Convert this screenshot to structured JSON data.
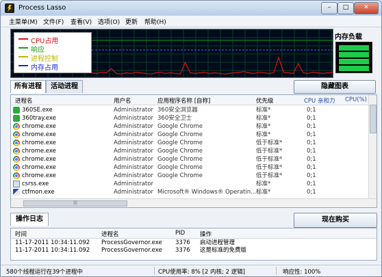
{
  "window": {
    "title": "Process Lasso",
    "minimize": "–",
    "maximize": "□",
    "close": "✕"
  },
  "menu": [
    {
      "label": "主菜单(M)"
    },
    {
      "label": "文件(F)"
    },
    {
      "label": "查看(V)"
    },
    {
      "label": "选项(O)"
    },
    {
      "label": "更新"
    },
    {
      "label": "帮助(H)"
    }
  ],
  "graph": {
    "legend": [
      {
        "label": "CPU占用",
        "color": "#e01010"
      },
      {
        "label": "响应",
        "color": "#1a9a1a"
      },
      {
        "label": "进程控制",
        "color": "#b8b800"
      },
      {
        "label": "内存占用",
        "color": "#1a2ad0"
      }
    ],
    "cpu_trace": [
      5,
      4,
      6,
      5,
      12,
      4,
      3,
      5,
      4,
      6,
      5,
      4,
      3,
      5,
      6,
      4,
      5,
      4,
      3,
      22,
      5,
      4,
      5,
      6,
      4,
      5,
      4,
      3,
      4,
      5,
      6,
      7,
      5,
      4,
      6,
      5,
      4,
      5,
      30,
      6,
      5,
      4,
      20,
      5,
      4,
      6,
      5,
      4,
      5,
      6
    ]
  },
  "memory": {
    "label": "内存负载"
  },
  "tabs": {
    "all_processes": "所有进程",
    "active_processes": "活动进程",
    "hide_graph_button": "隐藏图表"
  },
  "process_table": {
    "columns": [
      "进程名",
      "用户名",
      "应用程序名称 [自称]",
      "优先级",
      "CPU 亲和力",
      "CPU(%)"
    ],
    "rows": [
      {
        "icon": "green",
        "name": "360SE.exe",
        "user": "Administrator",
        "app": "360安全浏览器",
        "priority": "标准*",
        "affinity": "0;1"
      },
      {
        "icon": "green",
        "name": "360tray.exe",
        "user": "Administrator",
        "app": "360安全卫士",
        "priority": "标准*",
        "affinity": "0;1"
      },
      {
        "icon": "chrome",
        "name": "chrome.exe",
        "user": "Administrator",
        "app": "Google Chrome",
        "priority": "标准*",
        "affinity": "0;1"
      },
      {
        "icon": "chrome",
        "name": "chrome.exe",
        "user": "Administrator",
        "app": "Google Chrome",
        "priority": "标准*",
        "affinity": "0;1"
      },
      {
        "icon": "chrome",
        "name": "chrome.exe",
        "user": "Administrator",
        "app": "Google Chrome",
        "priority": "低于标准*",
        "affinity": "0;1"
      },
      {
        "icon": "chrome",
        "name": "chrome.exe",
        "user": "Administrator",
        "app": "Google Chrome",
        "priority": "低于标准*",
        "affinity": "0;1"
      },
      {
        "icon": "chrome",
        "name": "chrome.exe",
        "user": "Administrator",
        "app": "Google Chrome",
        "priority": "低于标准*",
        "affinity": "0;1"
      },
      {
        "icon": "chrome",
        "name": "chrome.exe",
        "user": "Administrator",
        "app": "Google Chrome",
        "priority": "低于标准*",
        "affinity": "0;1"
      },
      {
        "icon": "chrome",
        "name": "chrome.exe",
        "user": "Administrator",
        "app": "Google Chrome",
        "priority": "低于标准*",
        "affinity": "0;1"
      },
      {
        "icon": "win",
        "name": "csrss.exe",
        "user": "Administrator",
        "app": "",
        "priority": "标准*",
        "affinity": "0;1"
      },
      {
        "icon": "pen",
        "name": "ctfmon.exe",
        "user": "Administrator",
        "app": "Microsoft® Windows® Operatin...",
        "priority": "标准*",
        "affinity": "0;1"
      }
    ]
  },
  "log_section": {
    "tab": "操作日志",
    "buy_button": "现在购买",
    "columns": [
      "时间",
      "进程名",
      "PID",
      "操作"
    ],
    "rows": [
      {
        "time": "11-17-2011 10:34:11.092",
        "process": "ProcessGovernor.exe",
        "pid": "3376",
        "action": "启动进程管理"
      },
      {
        "time": "11-17-2011 10:34:11.092",
        "process": "ProcessGovernor.exe",
        "pid": "3376",
        "action": "这是标准的免费版"
      }
    ]
  },
  "status_bar": {
    "threads": "580个线程运行在39个进程中",
    "cpu": "CPU使用率: 8% [2 内核; 2 逻辑]",
    "responsiveness": "响应性: 100%"
  }
}
